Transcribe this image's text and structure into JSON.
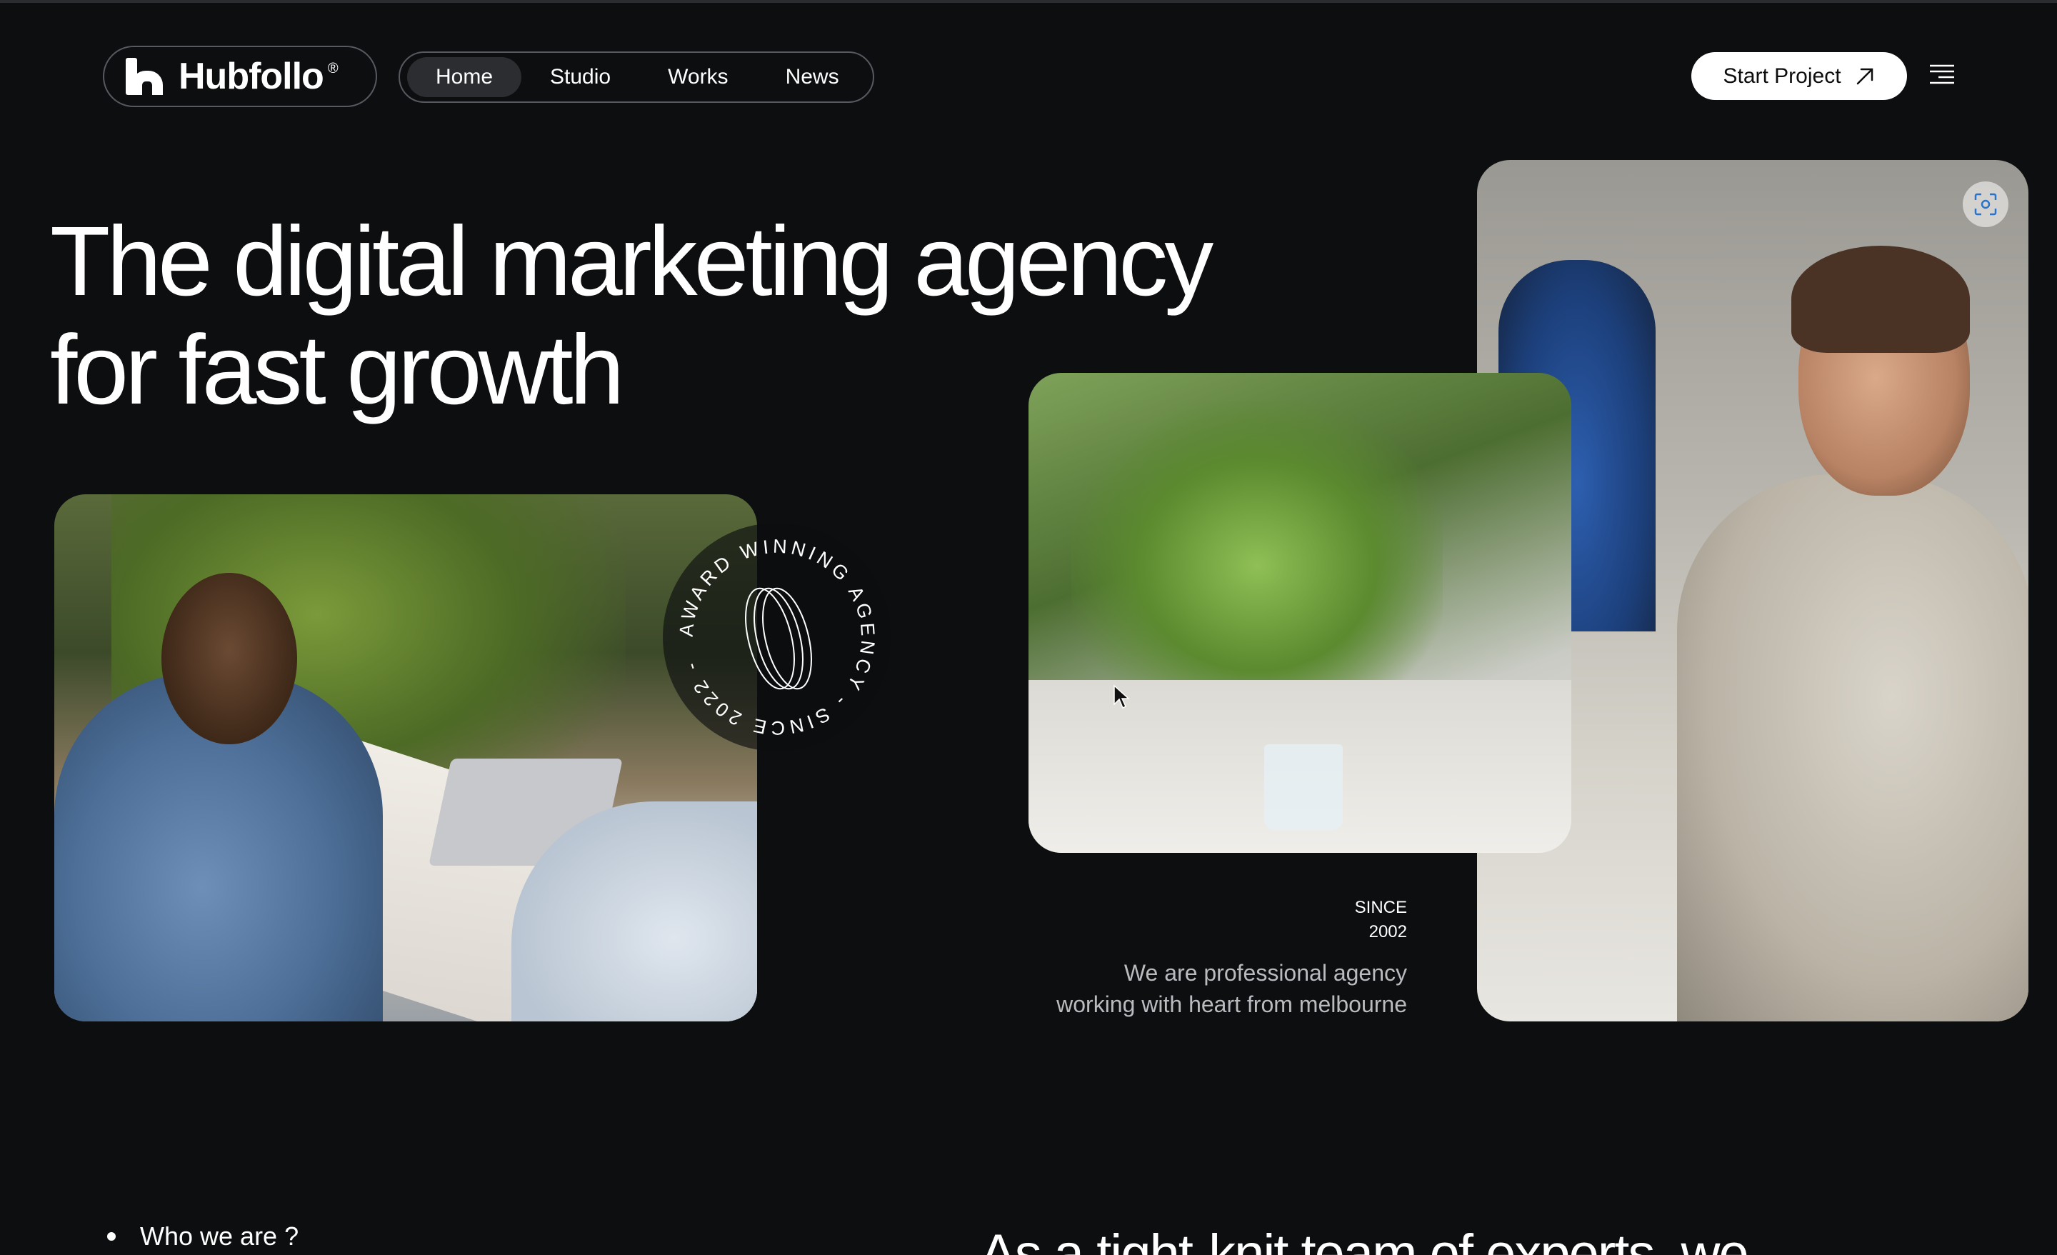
{
  "brand": {
    "name": "Hubfollo",
    "registered": "®"
  },
  "nav": {
    "items": [
      {
        "label": "Home",
        "active": true
      },
      {
        "label": "Studio",
        "active": false
      },
      {
        "label": "Works",
        "active": false
      },
      {
        "label": "News",
        "active": false
      }
    ]
  },
  "header": {
    "cta_label": "Start Project"
  },
  "hero": {
    "title_line1": "The digital marketing agency",
    "title_line2": "for fast growth"
  },
  "badge": {
    "text": "AWARD WINNING AGENCY - SINCE 2022 - "
  },
  "info": {
    "since_label": "SINCE",
    "since_year": "2002",
    "tagline_line1": "We are professional agency",
    "tagline_line2": "working with heart from melbourne"
  },
  "section": {
    "who_label": "Who we are ?",
    "teaser": "As a tight-knit team of experts, we"
  },
  "colors": {
    "background": "#0d0e10",
    "text": "#ffffff",
    "muted": "#b9bbbf",
    "border": "#56595f"
  }
}
